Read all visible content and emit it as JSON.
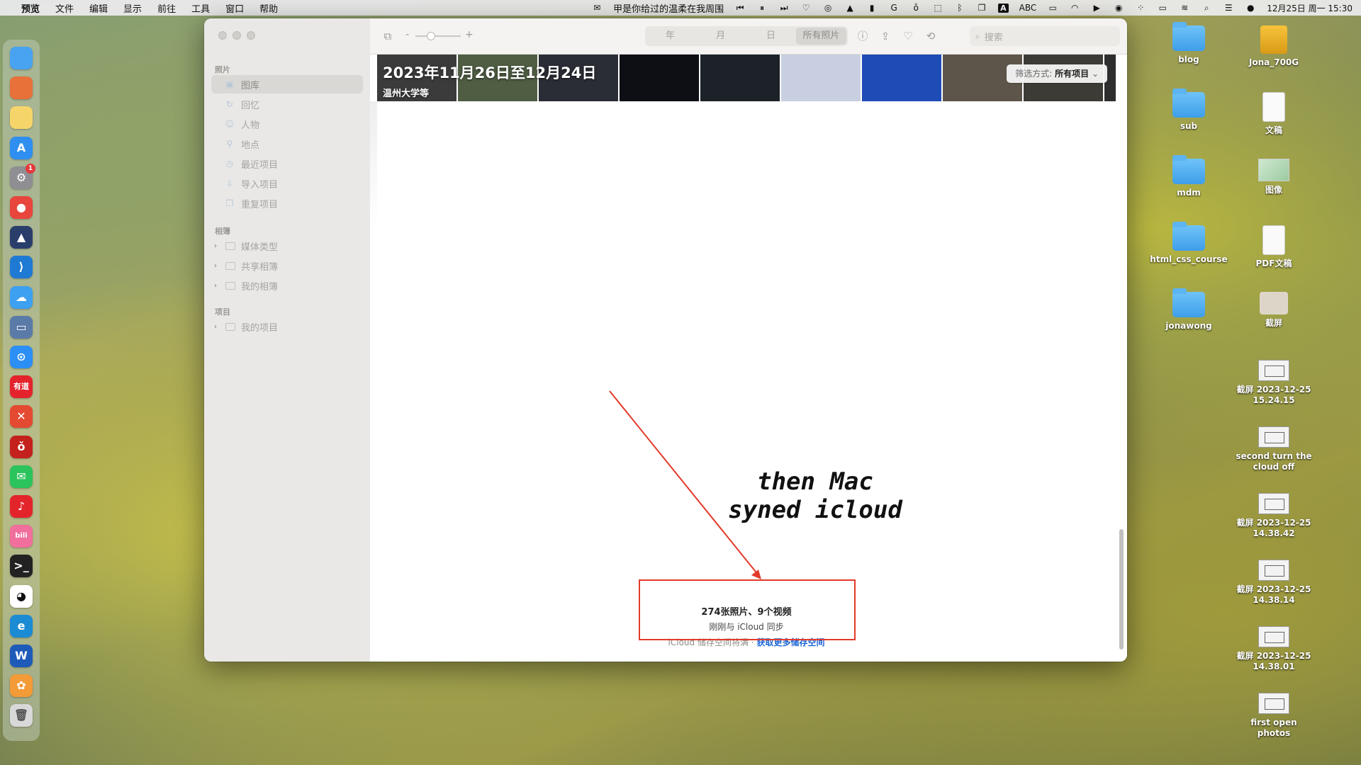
{
  "menubar": {
    "apple_icon": "apple-logo",
    "items": [
      "预览",
      "文件",
      "编辑",
      "显示",
      "前往",
      "工具",
      "窗口",
      "帮助"
    ],
    "now_playing": "甲是你给过的温柔在我周围",
    "input_method": "A",
    "input_label": "ABC",
    "datetime": "12月25日 周一 15:30"
  },
  "dock": {
    "apps": [
      {
        "name": "finder",
        "label": "",
        "color": "#4aa3f0"
      },
      {
        "name": "launchpad",
        "label": "",
        "color": "#e8713a"
      },
      {
        "name": "notes",
        "label": "",
        "color": "#f5d56a"
      },
      {
        "name": "app-store",
        "label": "A",
        "color": "#2f8ff0"
      },
      {
        "name": "system-settings",
        "label": "⚙",
        "color": "#8e8e93",
        "badge": "1"
      },
      {
        "name": "chrome",
        "label": "●",
        "color": "#e8453c"
      },
      {
        "name": "cursor",
        "label": "▲",
        "color": "#2a3e6b"
      },
      {
        "name": "vscode",
        "label": "⟩",
        "color": "#1f7ad3"
      },
      {
        "name": "baidu-netdisk",
        "label": "☁",
        "color": "#3da0f0"
      },
      {
        "name": "preview",
        "label": "▭",
        "color": "#5a7aa8"
      },
      {
        "name": "safari",
        "label": "⊙",
        "color": "#2c8ff5"
      },
      {
        "name": "youdao",
        "label": "有道",
        "color": "#e4232c"
      },
      {
        "name": "xmind",
        "label": "✕",
        "color": "#e44a32"
      },
      {
        "name": "app-red",
        "label": "ǒ",
        "color": "#c4211c"
      },
      {
        "name": "wechat",
        "label": "✉",
        "color": "#2bc35b"
      },
      {
        "name": "netease-music",
        "label": "♪",
        "color": "#e3242b"
      },
      {
        "name": "bilibili",
        "label": "bili",
        "color": "#f06f9c"
      },
      {
        "name": "terminal",
        "label": ">_",
        "color": "#222222"
      },
      {
        "name": "qq",
        "label": "◕",
        "color": "#ffffff"
      },
      {
        "name": "edge",
        "label": "e",
        "color": "#1b8bd4"
      },
      {
        "name": "word",
        "label": "W",
        "color": "#1e5ab8"
      },
      {
        "name": "photos",
        "label": "✿",
        "color": "#f29b37"
      },
      {
        "name": "trash",
        "label": "🗑",
        "color": "#d8d8d8"
      }
    ]
  },
  "window": {
    "sidebar": {
      "section_photos": "照片",
      "photos_items": [
        {
          "label": "图库",
          "icon": "library-icon",
          "selected": true
        },
        {
          "label": "回忆",
          "icon": "memories-icon"
        },
        {
          "label": "人物",
          "icon": "people-icon"
        },
        {
          "label": "地点",
          "icon": "places-icon"
        },
        {
          "label": "最近项目",
          "icon": "recents-icon"
        },
        {
          "label": "导入项目",
          "icon": "imports-icon"
        },
        {
          "label": "重复项目",
          "icon": "duplicates-icon"
        }
      ],
      "section_albums": "相簿",
      "album_items": [
        "媒体类型",
        "共享相簿",
        "我的相簿"
      ],
      "section_projects": "项目",
      "project_items": [
        "我的项目"
      ]
    },
    "toolbar": {
      "zoom_minus": "-",
      "zoom_plus": "+",
      "segments": [
        "年",
        "月",
        "日",
        "所有照片"
      ],
      "active_segment": "所有照片",
      "search_placeholder": "搜索"
    },
    "banner": {
      "title": "2023年11月26日至12月24日",
      "subtitle": "温州大学等",
      "filter_label": "筛选方式:",
      "filter_value": "所有项目",
      "thumbnail_colors": [
        "#3b3b3b",
        "#4f5d43",
        "#2a2d35",
        "#0e0f14",
        "#1d2128",
        "#c8cfe0",
        "#1e4bb5",
        "#5d554a",
        "#3d3b36",
        "#2e2e2e"
      ]
    },
    "summary": {
      "count": "274张照片、9个视频",
      "sync": "刚刚与 iCloud 同步",
      "storage": "iCloud 储存空间将满 ·",
      "storage_link": "获取更多储存空间"
    }
  },
  "annotation": {
    "line1": "then Mac",
    "line2": "syned icloud",
    "color": "#e23a2a"
  },
  "desktop_icons": [
    {
      "label": "blog",
      "type": "folder"
    },
    {
      "label": "Jona_700G",
      "type": "drive"
    },
    {
      "label": "sub",
      "type": "folder"
    },
    {
      "label": "文稿",
      "type": "doc"
    },
    {
      "label": "mdm",
      "type": "folder"
    },
    {
      "label": "图像",
      "type": "image"
    },
    {
      "label": "html_css_course",
      "type": "folder"
    },
    {
      "label": "PDF文稿",
      "type": "doc"
    },
    {
      "label": "jonawong",
      "type": "folder"
    },
    {
      "label": "截屏",
      "type": "folder-plain"
    },
    {
      "label": "截屏 2023-12-25 15.24.15",
      "type": "screenshot"
    },
    {
      "label": "second turn the cloud off",
      "type": "screenshot"
    },
    {
      "label": "截屏 2023-12-25 14.38.42",
      "type": "screenshot"
    },
    {
      "label": "截屏 2023-12-25 14.38.14",
      "type": "screenshot"
    },
    {
      "label": "截屏 2023-12-25 14.38.01",
      "type": "screenshot"
    },
    {
      "label": "first open photos",
      "type": "screenshot"
    }
  ]
}
